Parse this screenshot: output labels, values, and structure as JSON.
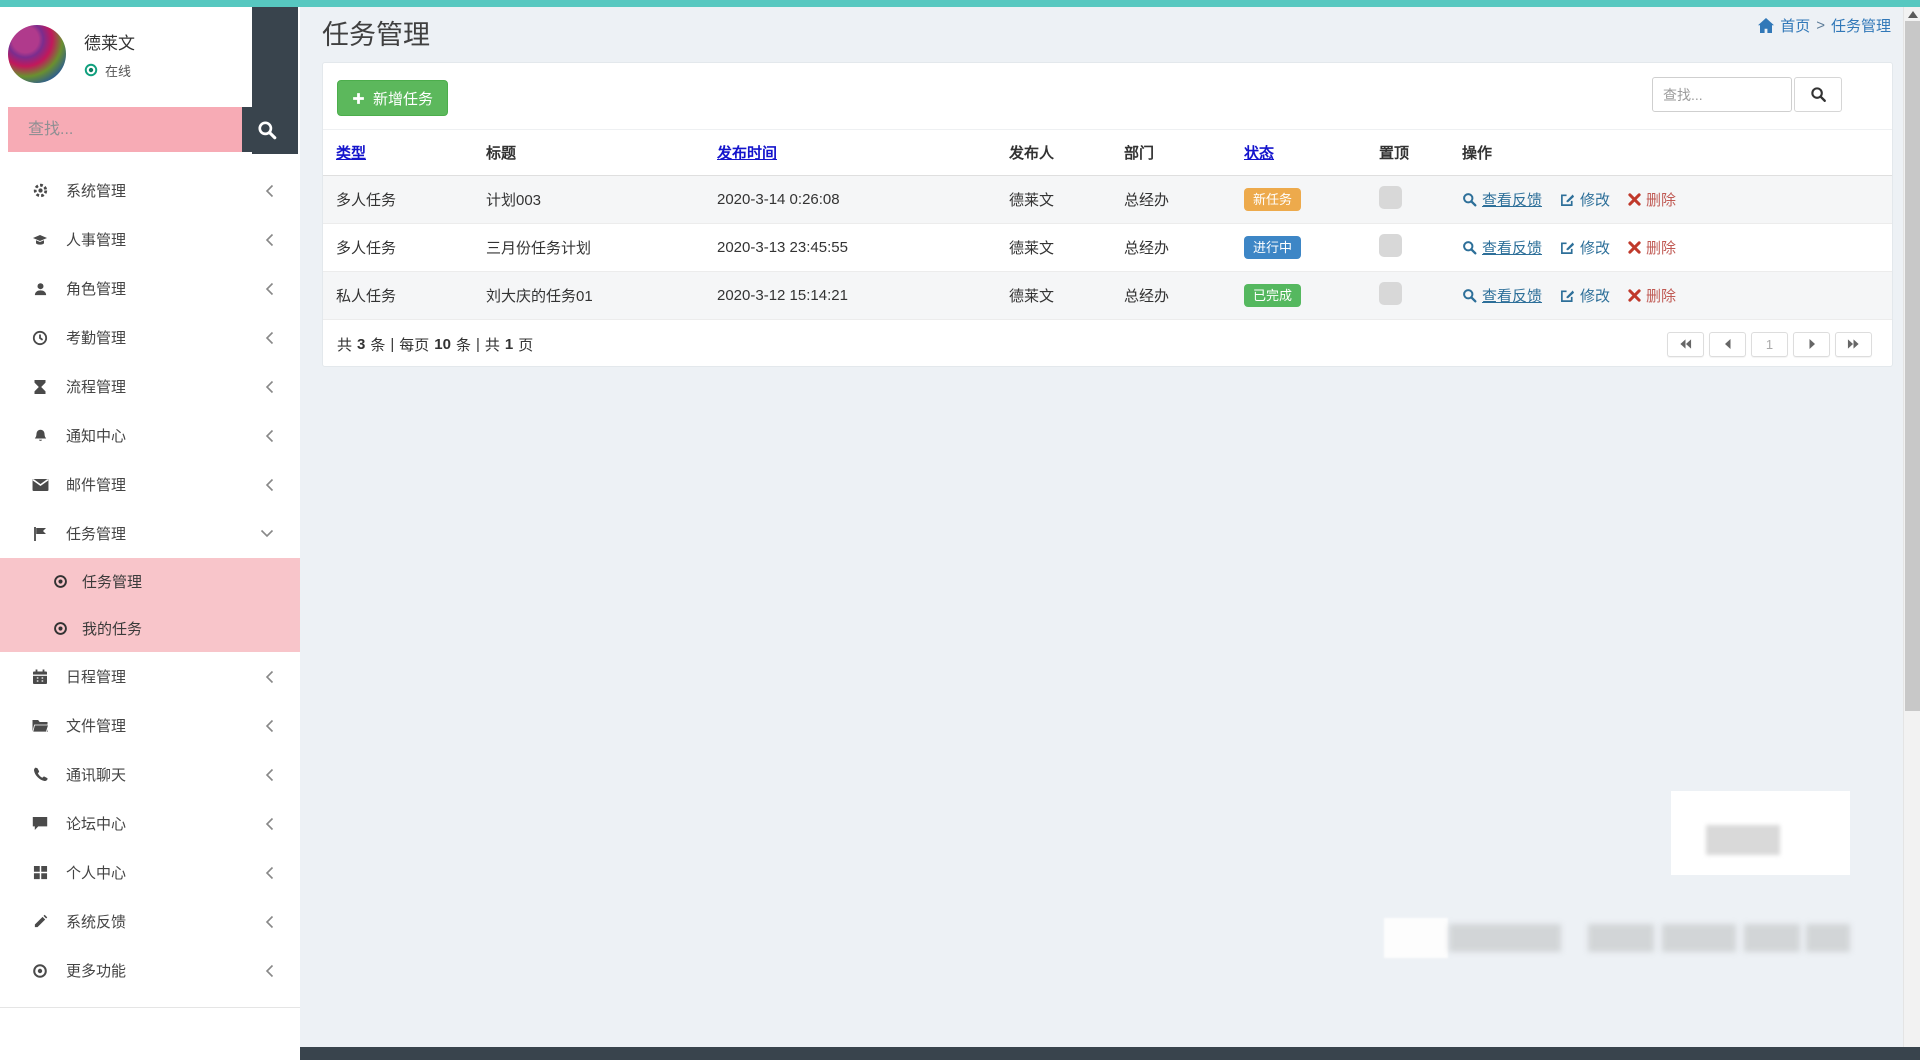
{
  "sidebar": {
    "user": {
      "name": "德莱文",
      "status": "在线",
      "status_icon": "online-status-icon"
    },
    "search_placeholder": "查找...",
    "search_icon": "search-icon",
    "items": [
      {
        "label": "系统管理",
        "icon": "gear-icon"
      },
      {
        "label": "人事管理",
        "icon": "graduation-cap-icon"
      },
      {
        "label": "角色管理",
        "icon": "user-icon"
      },
      {
        "label": "考勤管理",
        "icon": "clock-icon"
      },
      {
        "label": "流程管理",
        "icon": "hourglass-icon"
      },
      {
        "label": "通知中心",
        "icon": "bell-icon"
      },
      {
        "label": "邮件管理",
        "icon": "envelope-icon"
      },
      {
        "label": "任务管理",
        "icon": "flag-icon",
        "expanded": true
      },
      {
        "label": "日程管理",
        "icon": "calendar-icon"
      },
      {
        "label": "文件管理",
        "icon": "folder-icon"
      },
      {
        "label": "通讯聊天",
        "icon": "phone-icon"
      },
      {
        "label": "论坛中心",
        "icon": "comment-icon"
      },
      {
        "label": "个人中心",
        "icon": "grid-icon"
      },
      {
        "label": "系统反馈",
        "icon": "pencil-icon"
      },
      {
        "label": "更多功能",
        "icon": "circle-dot-icon"
      }
    ],
    "submenu": [
      {
        "label": "任务管理",
        "icon": "circle-dot-icon",
        "active": true
      },
      {
        "label": "我的任务",
        "icon": "circle-dot-icon",
        "active": true
      }
    ]
  },
  "breadcrumb": {
    "home_icon": "home-icon",
    "home": "首页",
    "separator": ">",
    "current": "任务管理"
  },
  "page": {
    "title": "任务管理"
  },
  "toolbar": {
    "add_button": "新增任务",
    "add_icon": "plus-icon",
    "search_placeholder": "查找...",
    "search_icon": "search-icon"
  },
  "table": {
    "headers": [
      {
        "label": "类型",
        "link": true
      },
      {
        "label": "标题",
        "link": false
      },
      {
        "label": "发布时间",
        "link": true
      },
      {
        "label": "发布人",
        "link": false
      },
      {
        "label": "部门",
        "link": false
      },
      {
        "label": "状态",
        "link": true
      },
      {
        "label": "置顶",
        "link": false
      },
      {
        "label": "操作",
        "link": false
      }
    ],
    "rows": [
      {
        "type": "多人任务",
        "title": "计划003",
        "time": "2020-3-14 0:26:08",
        "publisher": "德莱文",
        "dept": "总经办",
        "status": "新任务",
        "status_color": "#edaa4c"
      },
      {
        "type": "多人任务",
        "title": "三月份任务计划",
        "time": "2020-3-13 23:45:55",
        "publisher": "德莱文",
        "dept": "总经办",
        "status": "进行中",
        "status_color": "#3d86c6"
      },
      {
        "type": "私人任务",
        "title": "刘大庆的任务01",
        "time": "2020-3-12 15:14:21",
        "publisher": "德莱文",
        "dept": "总经办",
        "status": "已完成",
        "status_color": "#55b85f"
      }
    ],
    "actions": {
      "view": "查看反馈",
      "view_icon": "search-icon",
      "edit": "修改",
      "edit_icon": "edit-icon",
      "delete": "删除",
      "delete_icon": "x-icon"
    }
  },
  "pagination": {
    "total_label_1": "共",
    "total": "3",
    "total_label_2": "条",
    "sep": "|",
    "per_label_1": "每页",
    "per_page": "10",
    "per_label_2": "条",
    "pages_label_1": "共",
    "pages": "1",
    "pages_label_2": "页",
    "current_page": "1"
  },
  "colors": {
    "topbar_accent": "#57c8c0",
    "sidebar_search_pink": "#f7abb5",
    "submenu_pink": "#f8c5ca",
    "dark_slate": "#39444d",
    "add_button_green": "#5cb85c",
    "header_link_blue": "#1414cc",
    "breadcrumb_blue": "#3178b8",
    "status_new": "#edaa4c",
    "status_in_progress": "#3d86c6",
    "status_done": "#55b85f",
    "action_blue": "#2d6f99",
    "delete_red": "#c05a54"
  }
}
